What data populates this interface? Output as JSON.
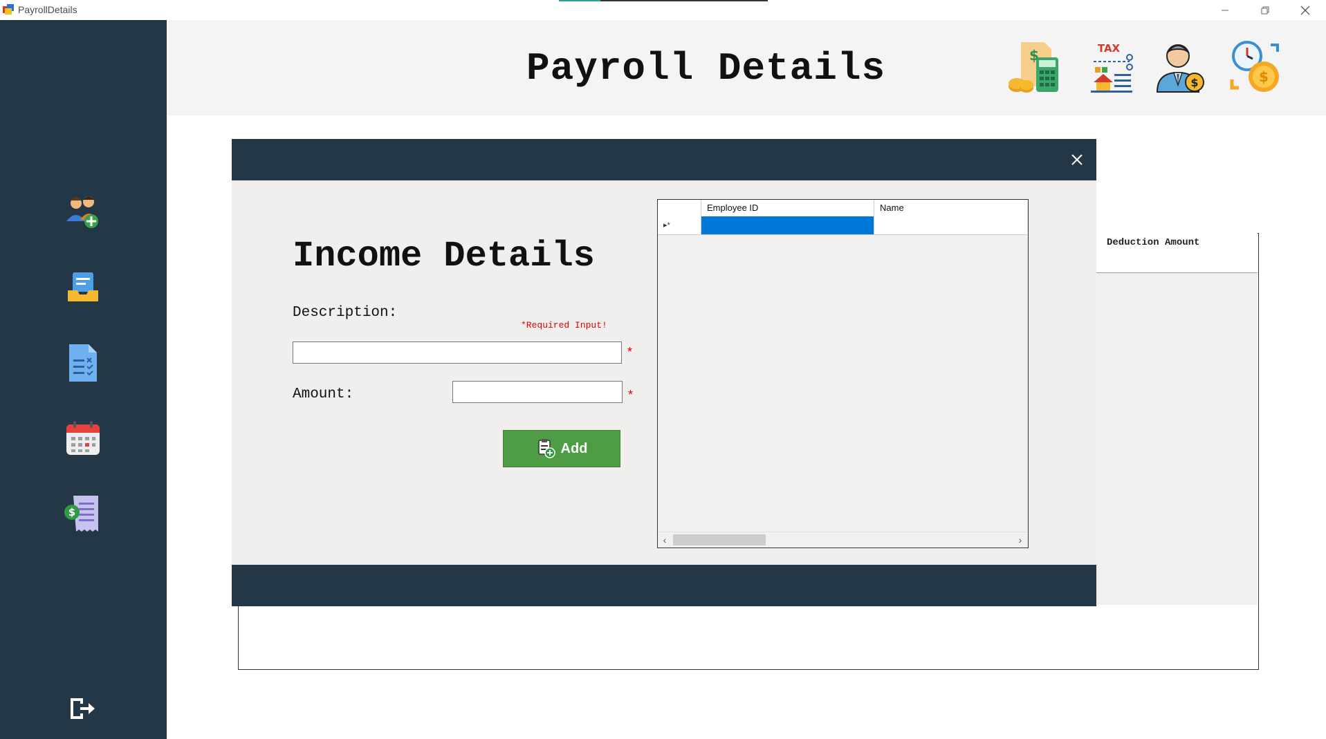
{
  "window": {
    "title": "PayrollDetails",
    "minimize_icon": "minimize-icon",
    "restore_icon": "restore-icon",
    "close_icon": "close-icon"
  },
  "sidebar": {
    "items": [
      {
        "icon": "add-employee-icon"
      },
      {
        "icon": "inbox-tray-icon"
      },
      {
        "icon": "checklist-document-icon"
      },
      {
        "icon": "calendar-icon"
      },
      {
        "icon": "payroll-receipt-icon"
      }
    ],
    "logout_icon": "logout-icon"
  },
  "header": {
    "title": "Payroll Details",
    "icons": [
      "salary-calculator-icon",
      "tax-icon",
      "employee-salary-icon",
      "time-is-money-icon"
    ],
    "tax_icon_text": "TAX"
  },
  "background_grid": {
    "column_title": "Deduction Amount"
  },
  "modal": {
    "title": "Income Details",
    "close_glyph": "✕",
    "description_label": "Description:",
    "required_text": "*Required Input!",
    "amount_label": "Amount:",
    "star": "*",
    "description_value": "",
    "amount_value": "",
    "add_label": "Add"
  },
  "grid": {
    "columns": [
      "Employee ID",
      "Name"
    ],
    "new_row_marker": "▸*",
    "scroll_left": "‹",
    "scroll_right": "›"
  },
  "colors": {
    "navy": "#243746",
    "add_green": "#4e9d44",
    "selected_cell": "#0078d7",
    "required_red": "#e00000"
  }
}
